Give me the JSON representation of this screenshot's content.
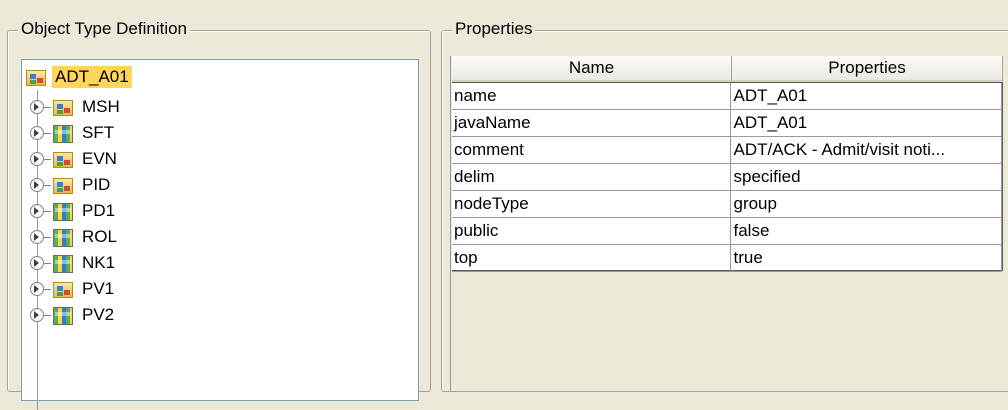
{
  "object_type_panel": {
    "title": "Object Type Definition",
    "tree": {
      "root": {
        "label": "ADT_A01",
        "icon": "folder-class-icon",
        "selected": true
      },
      "children": [
        {
          "label": "MSH",
          "icon": "folder-class-icon"
        },
        {
          "label": "SFT",
          "icon": "grid-class-icon"
        },
        {
          "label": "EVN",
          "icon": "folder-class-icon"
        },
        {
          "label": "PID",
          "icon": "folder-class-icon"
        },
        {
          "label": "PD1",
          "icon": "grid-class-icon"
        },
        {
          "label": "ROL",
          "icon": "grid-class-icon"
        },
        {
          "label": "NK1",
          "icon": "grid-class-icon"
        },
        {
          "label": "PV1",
          "icon": "folder-class-icon"
        },
        {
          "label": "PV2",
          "icon": "grid-class-icon"
        }
      ]
    }
  },
  "properties_panel": {
    "title": "Properties",
    "columns": [
      "Name",
      "Properties"
    ],
    "rows": [
      {
        "name": "name",
        "value": "ADT_A01"
      },
      {
        "name": "javaName",
        "value": "ADT_A01"
      },
      {
        "name": "comment",
        "value": "ADT/ACK - Admit/visit noti..."
      },
      {
        "name": "delim",
        "value": "specified"
      },
      {
        "name": "nodeType",
        "value": "group"
      },
      {
        "name": "public",
        "value": "false"
      },
      {
        "name": "top",
        "value": "true"
      }
    ]
  },
  "colors": {
    "selection": "#ffd65a",
    "window_bg": "#ece9d8",
    "tree_border": "#7f9db9"
  }
}
